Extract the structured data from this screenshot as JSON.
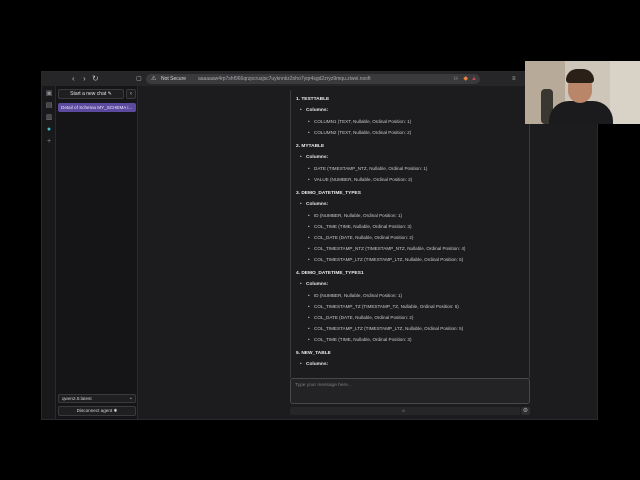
{
  "browser": {
    "not_secure_label": "Not Secure",
    "url": "aaaaaaw4rp7shf966qrzpcrusjsc7uyknnkz2oho7yqr4sgd2zryz9mqu.ziwei.nsoft",
    "icons": [
      "back-icon",
      "forward-icon",
      "reload-icon",
      "shield-icon",
      "extension-icon"
    ]
  },
  "sidebar": {
    "new_chat_label": "Start a new chat",
    "new_chat_icon": "✎",
    "collapse_icon": "‹",
    "chats": [
      {
        "label": "Detail of Schema MY_SCHEMA i..."
      }
    ],
    "model": "qwen2.5:latest",
    "disconnect_label": "Disconnect agent",
    "disconnect_icon": "✱"
  },
  "conversation": {
    "columns_label": "Columns:",
    "tables": [
      {
        "title": "1. TESTTABLE",
        "columns": [
          "COLUMN1 (TEXT, Nullable, Ordinal Position: 1)",
          "COLUMN2 (TEXT, Nullable, Ordinal Position: 2)"
        ]
      },
      {
        "title": "2. MYTABLE",
        "columns": [
          "DATE (TIMESTAMP_NTZ, Nullable, Ordinal Position: 1)",
          "VALUE (NUMBER, Nullable, Ordinal Position: 2)"
        ]
      },
      {
        "title": "3. DEMO_DATETIME_TYPES",
        "columns": [
          "ID (NUMBER, Nullable, Ordinal Position: 1)",
          "COL_TIME (TIME, Nullable, Ordinal Position: 3)",
          "COL_DATE (DATE, Nullable, Ordinal Position: 2)",
          "COL_TIMESTAMP_NTZ (TIMESTAMP_NTZ, Nullable, Ordinal Position: 4)",
          "COL_TIMESTAMP_LTZ (TIMESTAMP_LTZ, Nullable, Ordinal Position: 5)"
        ]
      },
      {
        "title": "4. DEMO_DATETIME_TYPES1",
        "columns": [
          "ID (NUMBER, Nullable, Ordinal Position: 1)",
          "COL_TIMESTAMP_TZ (TIMESTAMP_TZ, Nullable, Ordinal Position: 6)",
          "COL_DATE (DATE, Nullable, Ordinal Position: 2)",
          "COL_TIMESTAMP_LTZ (TIMESTAMP_LTZ, Nullable, Ordinal Position: 5)",
          "COL_TIME (TIME, Nullable, Ordinal Position: 3)"
        ]
      },
      {
        "title": "5. NEW_TABLE",
        "columns": []
      }
    ]
  },
  "composer": {
    "placeholder": "Type your message here..."
  }
}
